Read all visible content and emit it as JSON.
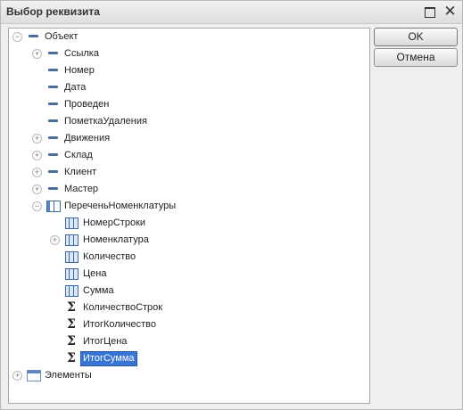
{
  "window": {
    "title": "Выбор реквизита"
  },
  "buttons": {
    "ok": "OK",
    "cancel": "Отмена"
  },
  "tree": {
    "root": "Объект",
    "items": [
      {
        "label": "Ссылка"
      },
      {
        "label": "Номер"
      },
      {
        "label": "Дата"
      },
      {
        "label": "Проведен"
      },
      {
        "label": "ПометкаУдаления"
      },
      {
        "label": "Движения"
      },
      {
        "label": "Склад"
      },
      {
        "label": "Клиент"
      },
      {
        "label": "Мастер"
      },
      {
        "label": "ПереченьНоменклатуры"
      }
    ],
    "table_items": [
      {
        "label": "НомерСтроки"
      },
      {
        "label": "Номенклатура"
      },
      {
        "label": "Количество"
      },
      {
        "label": "Цена"
      },
      {
        "label": "Сумма"
      },
      {
        "label": "КоличествоСтрок"
      },
      {
        "label": "ИтогКоличество"
      },
      {
        "label": "ИтогЦена"
      },
      {
        "label": "ИтогСумма"
      }
    ],
    "second_root": "Элементы",
    "selected": "ИтогСумма"
  },
  "icons": [
    "expand-icon",
    "collapse-icon",
    "field-icon",
    "table-icon",
    "column-icon",
    "sigma-icon",
    "list-icon",
    "maximize-icon",
    "close-icon"
  ]
}
